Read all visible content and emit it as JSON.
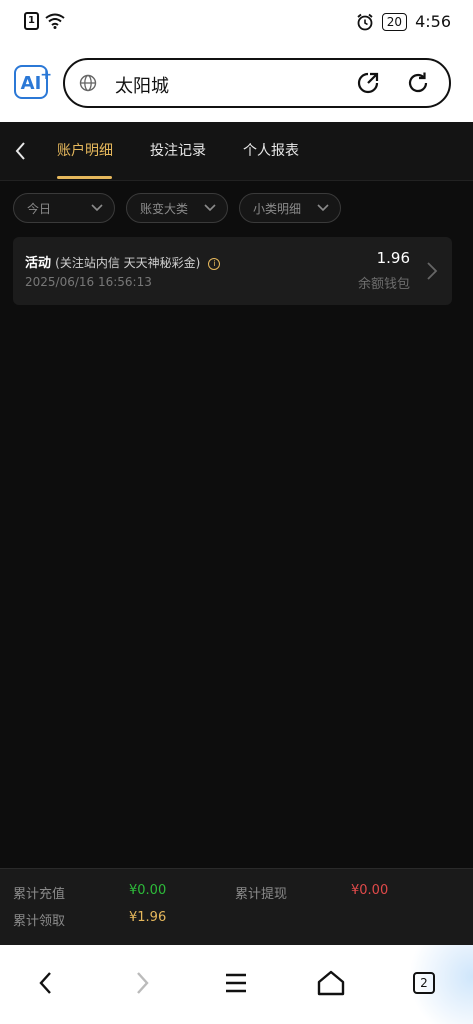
{
  "status_bar": {
    "sim_label": "1",
    "battery": "20",
    "time": "4:56"
  },
  "browser": {
    "url_text": "太阳城",
    "tab_count": "2"
  },
  "tabs": [
    {
      "label": "账户明细",
      "active": true
    },
    {
      "label": "投注记录",
      "active": false
    },
    {
      "label": "个人报表",
      "active": false
    }
  ],
  "filters": [
    {
      "label": "今日"
    },
    {
      "label": "账变大类"
    },
    {
      "label": "小类明细"
    }
  ],
  "records": [
    {
      "title": "活动",
      "subtitle": "(关注站内信 天天神秘彩金)",
      "info_icon_glyph": "i",
      "date": "2025/06/16 16:56:13",
      "amount": "1.96",
      "wallet": "余额钱包"
    }
  ],
  "summary": {
    "recharge_label": "累计充值",
    "recharge_value": "¥0.00",
    "withdraw_label": "累计提现",
    "withdraw_value": "¥0.00",
    "claim_label": "累计领取",
    "claim_value": "¥1.96"
  },
  "colors": {
    "accent": "#e6b85c",
    "recharge": "#2dbb3a",
    "withdraw": "#e04a4a",
    "background": "#0d0d0d"
  },
  "icons": {
    "status": [
      "sim-icon",
      "wifi-icon",
      "alarm-icon",
      "battery-icon"
    ],
    "browser": [
      "ai-logo-icon",
      "globe-icon",
      "share-icon",
      "reload-icon"
    ],
    "nav": [
      "back-icon",
      "forward-icon",
      "menu-icon",
      "home-icon",
      "tabs-icon"
    ]
  }
}
